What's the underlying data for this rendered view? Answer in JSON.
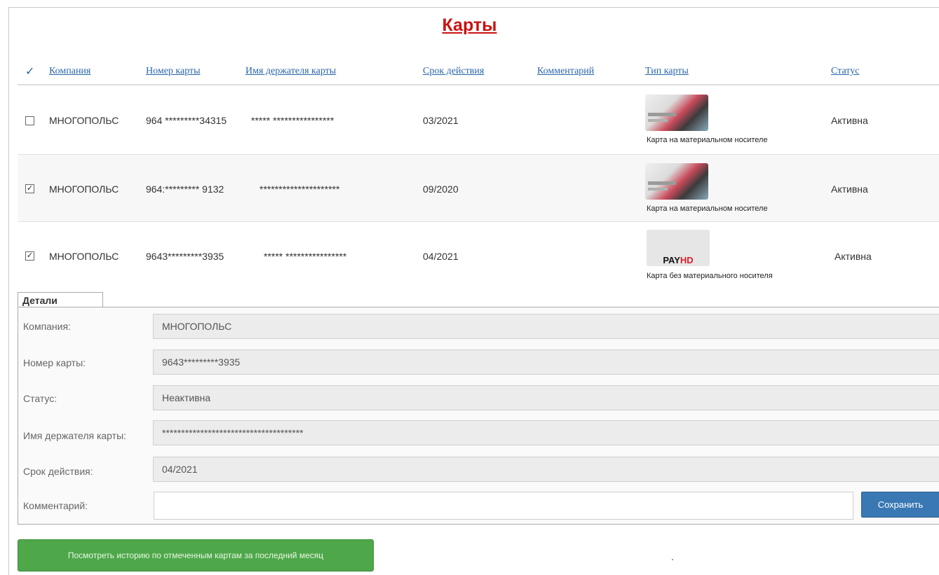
{
  "page_title": "Карты",
  "table": {
    "check_mark": "✓",
    "columns": [
      "Компания",
      "Номер карты",
      "Имя держателя карты",
      "Срок действия",
      "Комментарий",
      "Тип карты",
      "Статус"
    ],
    "rows": [
      {
        "checked": false,
        "company": "МНОГОПОЛЬС",
        "number": "964 *********34315",
        "holder": "***** ****************",
        "expiry": "03/2021",
        "comment": "",
        "card_type": "Карта на материальном носителе",
        "card_image": "material-card",
        "status": "Активна"
      },
      {
        "checked": true,
        "company": "МНОГОПОЛЬС",
        "number": "964:********* 9132",
        "holder": "*********************",
        "expiry": "09/2020",
        "comment": "",
        "card_type": "Карта на материальном носителе",
        "card_image": "material-card",
        "status": "Активна"
      },
      {
        "checked": true,
        "company": "МНОГОПОЛЬС",
        "number": "9643*********3935",
        "holder": "***** ****************",
        "expiry": "04/2021",
        "comment": "",
        "card_type": "Карта без материального носителя",
        "card_image": "virtual-card",
        "status": "Активна"
      }
    ]
  },
  "virtual_logo": {
    "pay": "PAY",
    "hd": "HD"
  },
  "details": {
    "tab_label": "Детали",
    "labels": {
      "company": "Компания:",
      "number": "Номер карты:",
      "status": "Статус:",
      "holder": "Имя держателя карты:",
      "expiry": "Срок действия:",
      "comment": "Комментарий:"
    },
    "values": {
      "company": "МНОГОПОЛЬС",
      "number": "9643*********3935",
      "status": "Неактивна",
      "holder": "*************************************",
      "expiry": "04/2021",
      "comment": ""
    },
    "save_label": "Сохранить"
  },
  "history_button_label": "Посмотреть историю по отмеченным картам за последний месяц",
  "colors": {
    "title": "#cc1111",
    "link": "#2a66a8",
    "save": "#3a78b4",
    "history": "#4ea84a"
  }
}
